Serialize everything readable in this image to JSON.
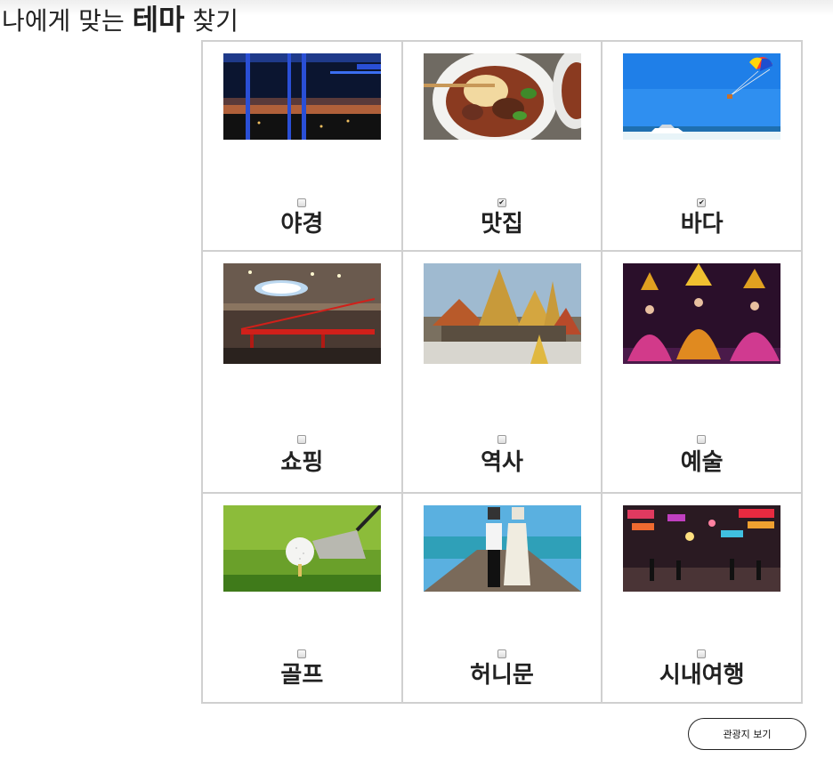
{
  "header": {
    "title_prefix": "나에게 맞는 ",
    "title_emphasis": "테마",
    "title_suffix": " 찾기"
  },
  "themes": [
    {
      "label": "야경",
      "checked": false,
      "image": "night-view-photo"
    },
    {
      "label": "맛집",
      "checked": true,
      "image": "noodle-soup-photo"
    },
    {
      "label": "바다",
      "checked": true,
      "image": "parasailing-sea-photo"
    },
    {
      "label": "쇼핑",
      "checked": false,
      "image": "shopping-mall-photo"
    },
    {
      "label": "역사",
      "checked": false,
      "image": "temple-photo"
    },
    {
      "label": "예술",
      "checked": false,
      "image": "dance-show-photo"
    },
    {
      "label": "골프",
      "checked": false,
      "image": "golf-ball-photo"
    },
    {
      "label": "허니문",
      "checked": false,
      "image": "honeymoon-pier-photo"
    },
    {
      "label": "시내여행",
      "checked": false,
      "image": "city-street-photo"
    }
  ],
  "actions": {
    "view_label": "관광지 보기"
  }
}
